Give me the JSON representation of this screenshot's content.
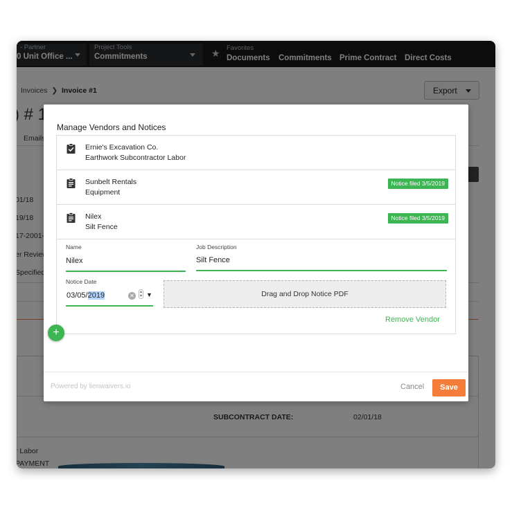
{
  "topnav": {
    "partner_small": "- Partner",
    "partner_big": "0 Unit Office ...",
    "tools_small": "Project Tools",
    "tools_big": "Commitments",
    "favorites_small": "Favorites",
    "links": [
      "Documents",
      "Commitments",
      "Prime Contract",
      "Direct Costs"
    ]
  },
  "breadcrumb": {
    "parent": "Invoices",
    "current": "Invoice #1"
  },
  "export_label": "Export",
  "background": {
    "title": ") # 1",
    "tab_emails": "Emails",
    "fields": [
      "01/18",
      "19/18",
      "17-2001-",
      "er Review",
      "Specified"
    ],
    "subcontract_date_label": "SUBCONTRACT DATE:",
    "subcontract_date_value": "02/01/18",
    "labor_text": "r Labor",
    "payment_text": "PAYMENT"
  },
  "modal": {
    "title": "Manage Vendors and Notices",
    "vendors": [
      {
        "name": "Ernie's Excavation Co.",
        "description": "Earthwork Subcontractor Labor",
        "icon": "clipboard-check-icon",
        "badge": ""
      },
      {
        "name": "Sunbelt Rentals",
        "description": "Equipment",
        "icon": "clipboard-list-icon",
        "badge": "Notice filed 3/5/2019"
      },
      {
        "name": "Nilex",
        "description": "Silt Fence",
        "icon": "clipboard-list-icon",
        "badge": "Notice filed 3/5/2019"
      }
    ],
    "form": {
      "name_label": "Name",
      "name_value": "Nilex",
      "job_label": "Job Description",
      "job_value": "Silt Fence",
      "date_label": "Notice Date",
      "date_prefix": "03/05/",
      "date_selected": "2019",
      "dropzone": "Drag and Drop Notice PDF",
      "remove": "Remove Vendor"
    },
    "add_symbol": "+",
    "powered_by": "Powered by lienwaivers.io",
    "cancel": "Cancel",
    "save": "Save"
  },
  "colors": {
    "accent_green": "#3db553",
    "save_orange": "#f47d3a",
    "nav_dark": "#18191b"
  }
}
